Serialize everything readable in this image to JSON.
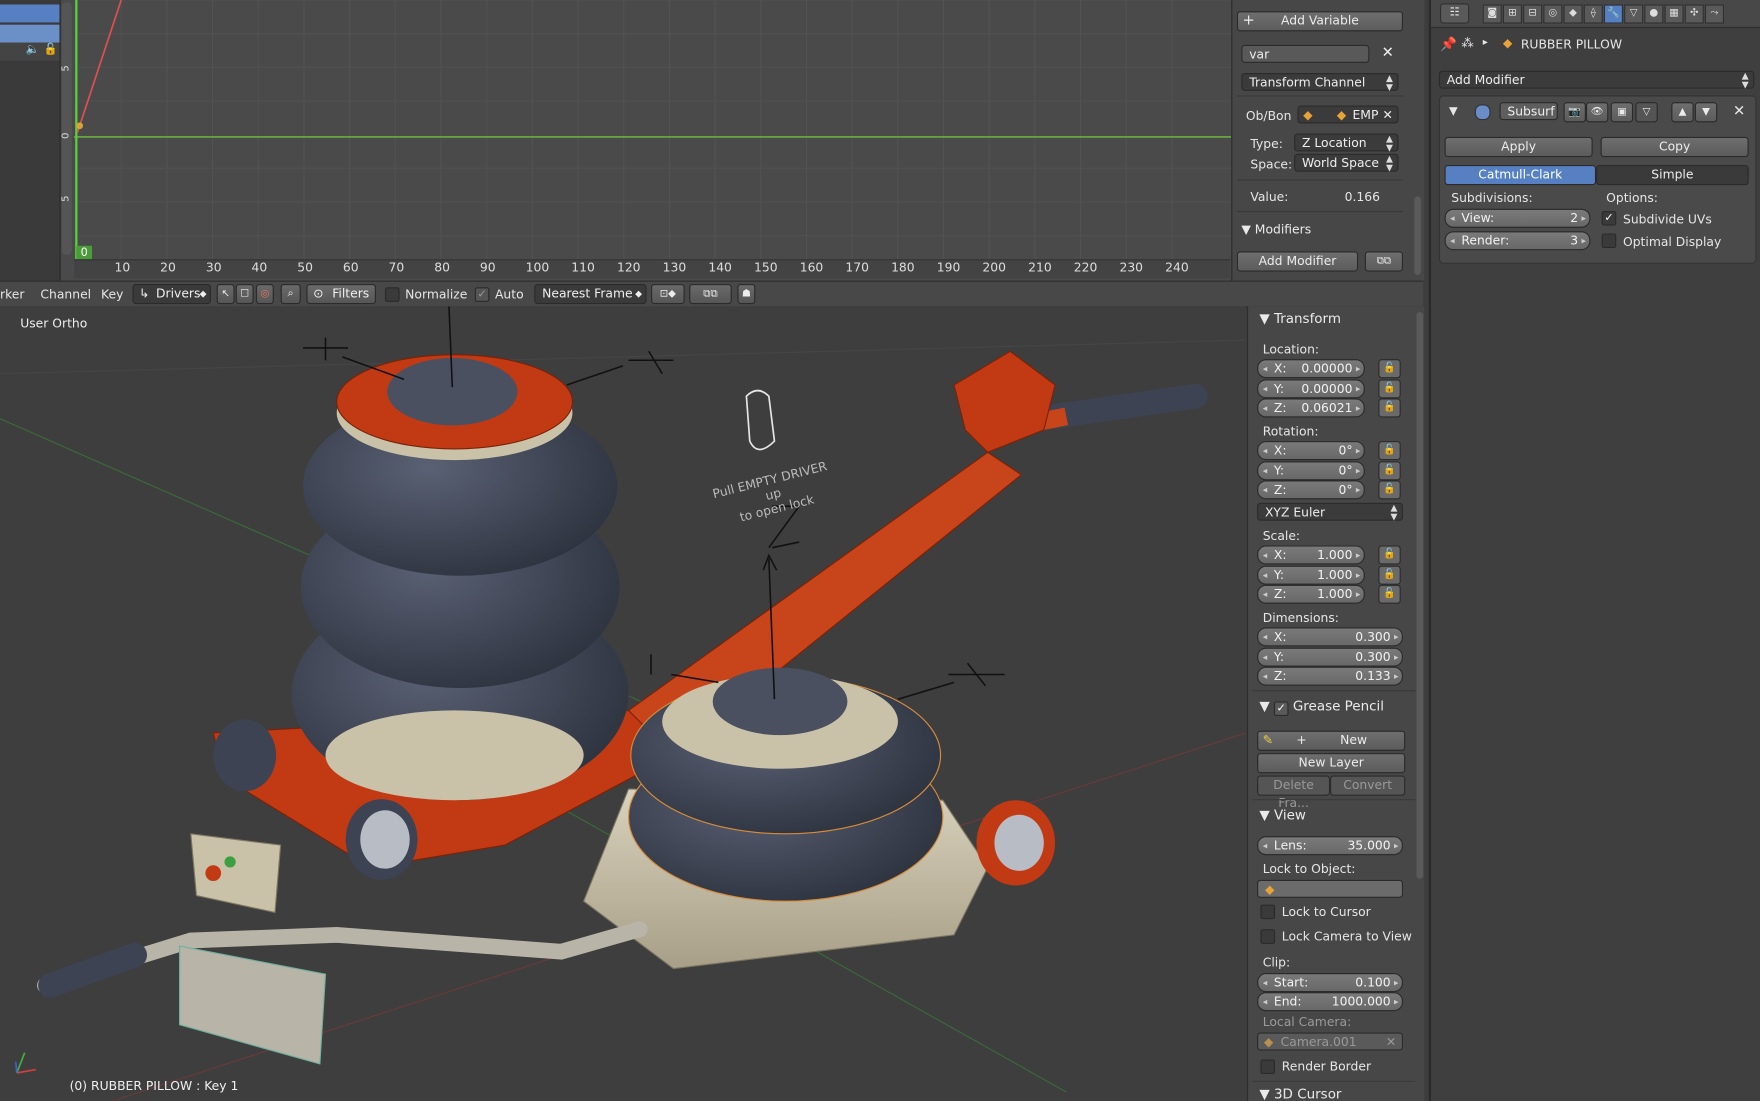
{
  "graph_editor": {
    "y_ticks": [
      "5",
      "0",
      "5"
    ],
    "current_frame": "0",
    "x_ticks": [
      "10",
      "20",
      "30",
      "40",
      "50",
      "60",
      "70",
      "80",
      "90",
      "100",
      "110",
      "120",
      "130",
      "140",
      "150",
      "160",
      "170",
      "180",
      "190",
      "200",
      "210",
      "220",
      "230",
      "240"
    ]
  },
  "drivers_panel": {
    "add_variable": "Add Variable",
    "var_name": "var",
    "var_type": "Transform Channel",
    "ob_bon_label": "Ob/Bon",
    "ob_bon_value": "EMP",
    "type_label": "Type:",
    "type_value": "Z Location",
    "space_label": "Space:",
    "space_value": "World Space",
    "value_label": "Value:",
    "value": "0.166",
    "modifiers_title": "Modifiers",
    "add_modifier": "Add Modifier"
  },
  "header_bar": {
    "menu_marker": "rker",
    "menu_channel": "Channel",
    "menu_key": "Key",
    "mode": "Drivers",
    "filters": "Filters",
    "normalize": "Normalize",
    "auto": "Auto",
    "snap": "Nearest Frame"
  },
  "viewport": {
    "view_label": "User Ortho",
    "status": "(0) RUBBER PILLOW : Key 1",
    "annotation_line1": "Pull EMPTY DRIVER up",
    "annotation_line2": "to open lock",
    "colors": {
      "red": "#c23a14",
      "rubber": "#3d4352",
      "beige": "#c9c1a8",
      "grid_green": "#3b6a3b"
    }
  },
  "npanel": {
    "transform_title": "Transform",
    "location_label": "Location:",
    "location": [
      {
        "axis": "X:",
        "value": "0.00000"
      },
      {
        "axis": "Y:",
        "value": "0.00000"
      },
      {
        "axis": "Z:",
        "value": "0.06021"
      }
    ],
    "rotation_label": "Rotation:",
    "rotation": [
      {
        "axis": "X:",
        "value": "0°"
      },
      {
        "axis": "Y:",
        "value": "0°"
      },
      {
        "axis": "Z:",
        "value": "0°"
      }
    ],
    "rotation_mode": "XYZ Euler",
    "scale_label": "Scale:",
    "scale": [
      {
        "axis": "X:",
        "value": "1.000"
      },
      {
        "axis": "Y:",
        "value": "1.000"
      },
      {
        "axis": "Z:",
        "value": "1.000"
      }
    ],
    "dimensions_label": "Dimensions:",
    "dimensions": [
      {
        "axis": "X:",
        "value": "0.300"
      },
      {
        "axis": "Y:",
        "value": "0.300"
      },
      {
        "axis": "Z:",
        "value": "0.133"
      }
    ],
    "grease_pencil_title": "Grease Pencil",
    "gp_new": "New",
    "gp_new_layer": "New Layer",
    "gp_delete_frame": "Delete Fra...",
    "gp_convert": "Convert",
    "view_title": "View",
    "lens_label": "Lens:",
    "lens_value": "35.000",
    "lock_to_object_label": "Lock to Object:",
    "lock_to_cursor": "Lock to Cursor",
    "lock_camera_to_view": "Lock Camera to View",
    "clip_label": "Clip:",
    "clip_start_label": "Start:",
    "clip_start": "0.100",
    "clip_end_label": "End:",
    "clip_end": "1000.000",
    "local_camera_label": "Local Camera:",
    "local_camera": "Camera.001",
    "render_border": "Render Border",
    "cursor_title": "3D Cursor"
  },
  "properties": {
    "object_name": "RUBBER PILLOW",
    "add_modifier": "Add Modifier",
    "modifier_name": "Subsurf",
    "apply": "Apply",
    "copy": "Copy",
    "tab_catmull": "Catmull-Clark",
    "tab_simple": "Simple",
    "subdivisions_label": "Subdivisions:",
    "options_label": "Options:",
    "view_label": "View:",
    "view_value": "2",
    "render_label": "Render:",
    "render_value": "3",
    "subdivide_uvs": "Subdivide UVs",
    "optimal_display": "Optimal Display",
    "accent": "#5680c2"
  }
}
